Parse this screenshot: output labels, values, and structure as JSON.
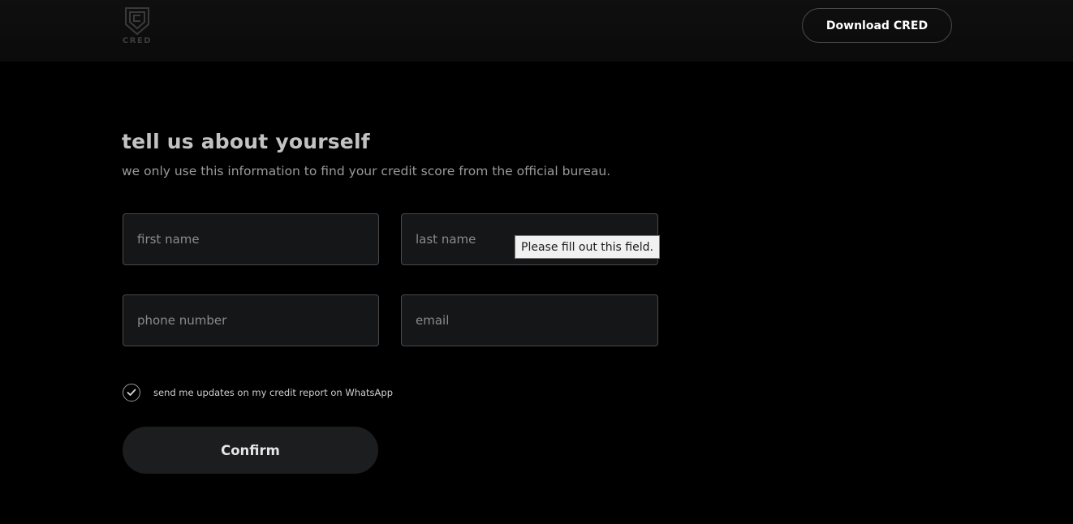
{
  "header": {
    "logo_text": "CRED",
    "download_label": "Download CRED"
  },
  "form": {
    "title": "tell us about yourself",
    "subtitle": "we only use this information to find your credit score from the official bureau.",
    "first_name_placeholder": "first name",
    "last_name_placeholder": "last name",
    "phone_placeholder": "phone number",
    "email_placeholder": "email",
    "validation_tooltip": "Please fill out this field.",
    "whatsapp_label": "send me updates on my credit report on WhatsApp",
    "whatsapp_checked": true,
    "confirm_label": "Confirm"
  },
  "icons": {
    "logo": "cred-shield-logo",
    "check": "checkmark-icon"
  },
  "colors": {
    "background": "#000000",
    "header_bg": "#0d0d0e",
    "field_bg": "#151618",
    "button_bg": "#1c1d1f"
  }
}
